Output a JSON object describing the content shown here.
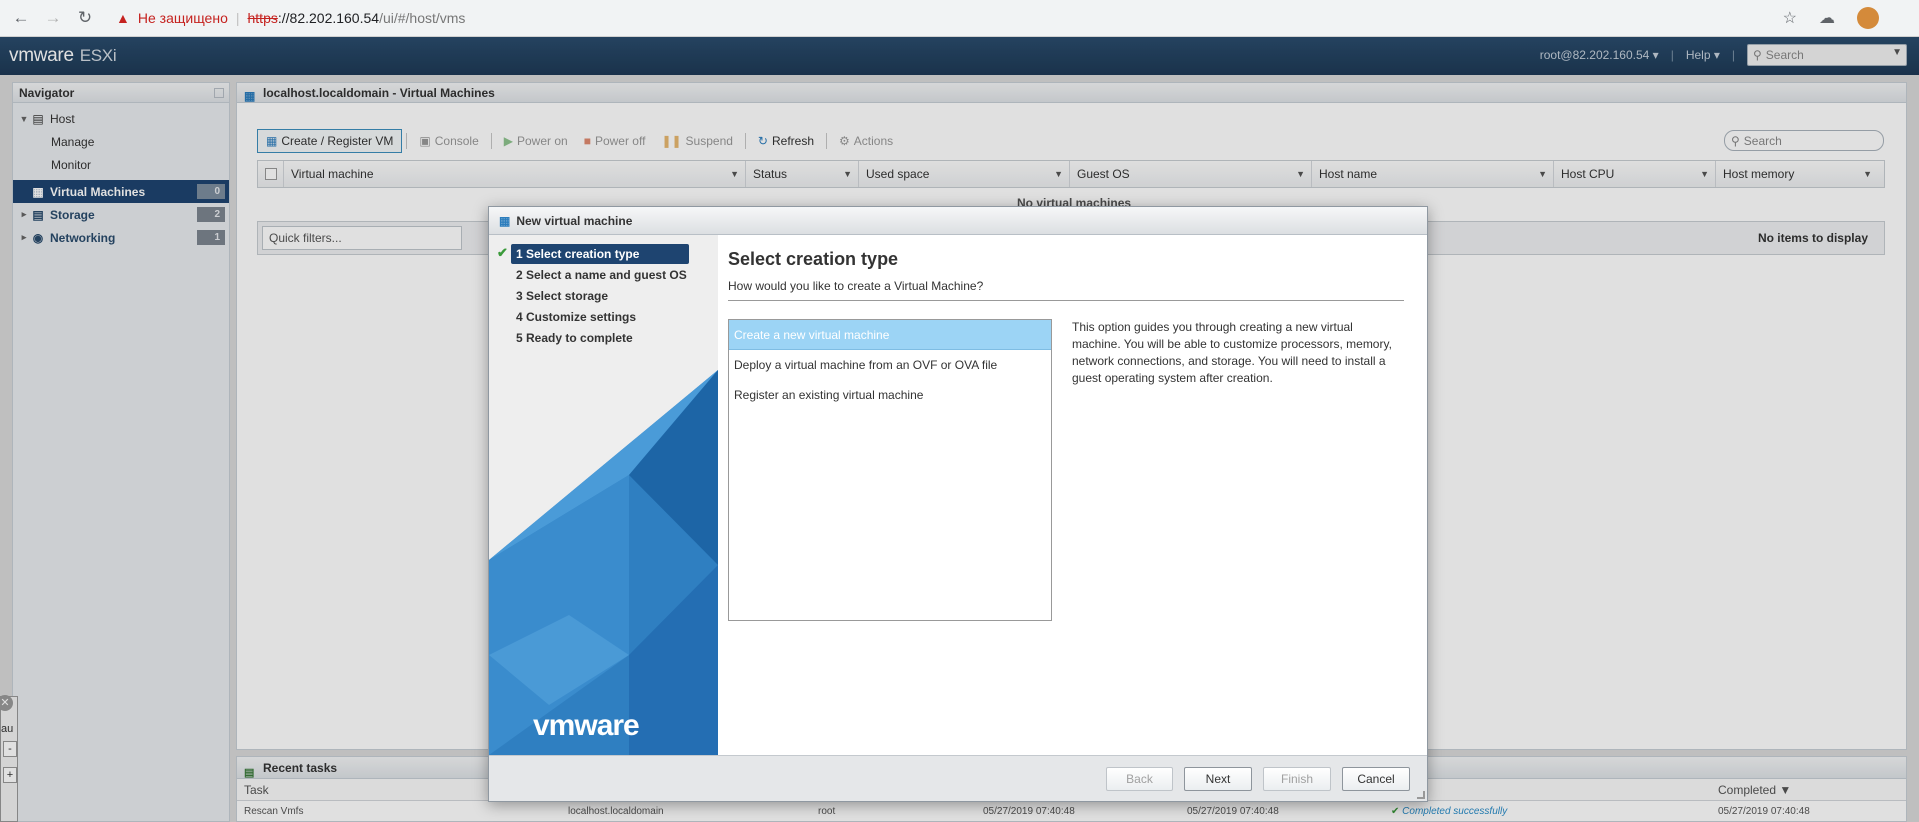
{
  "browser": {
    "insecure_label": "Не защищено",
    "url_scheme": "https",
    "url_host": "://82.202.160.54",
    "url_path": "/ui/#/host/vms"
  },
  "header": {
    "logo": "vmware",
    "product": "ESXi",
    "user": "root@82.202.160.54 ▾",
    "help": "Help ▾",
    "search_placeholder": "Search"
  },
  "navigator": {
    "title": "Navigator",
    "host": "Host",
    "manage": "Manage",
    "monitor": "Monitor",
    "items": [
      {
        "label": "Virtual Machines",
        "count": "0"
      },
      {
        "label": "Storage",
        "count": "2"
      },
      {
        "label": "Networking",
        "count": "1"
      }
    ]
  },
  "main": {
    "title": "localhost.localdomain - Virtual Machines",
    "toolbar": {
      "create": "Create / Register VM",
      "console": "Console",
      "power_on": "Power on",
      "power_off": "Power off",
      "suspend": "Suspend",
      "refresh": "Refresh",
      "actions": "Actions",
      "search": "Search"
    },
    "columns": [
      "Virtual machine",
      "Status",
      "Used space",
      "Guest OS",
      "Host name",
      "Host CPU",
      "Host memory"
    ],
    "empty_text": "No virtual machines",
    "quick_filters": "Quick filters...",
    "no_items": "No items to display"
  },
  "recent_tasks": {
    "title": "Recent tasks",
    "columns": [
      "Task",
      "Completed ▼"
    ],
    "row": {
      "task": "Rescan Vmfs",
      "target": "localhost.localdomain",
      "initiator": "root",
      "queued": "05/27/2019 07:40:48",
      "started": "05/27/2019 07:40:48",
      "result": "Completed successfully",
      "completed": "05/27/2019 07:40:48"
    }
  },
  "stub": {
    "text": "au"
  },
  "dialog": {
    "title": "New virtual machine",
    "steps": [
      "1 Select creation type",
      "2 Select a name and guest OS",
      "3 Select storage",
      "4 Customize settings",
      "5 Ready to complete"
    ],
    "logo": "vmware",
    "heading": "Select creation type",
    "subheading": "How would you like to create a Virtual Machine?",
    "options": [
      "Create a new virtual machine",
      "Deploy a virtual machine from an OVF or OVA file",
      "Register an existing virtual machine"
    ],
    "description": "This option guides you through creating a new virtual machine. You will be able to customize processors, memory, network connections, and storage. You will need to install a guest operating system after creation.",
    "buttons": {
      "back": "Back",
      "next": "Next",
      "finish": "Finish",
      "cancel": "Cancel"
    }
  }
}
